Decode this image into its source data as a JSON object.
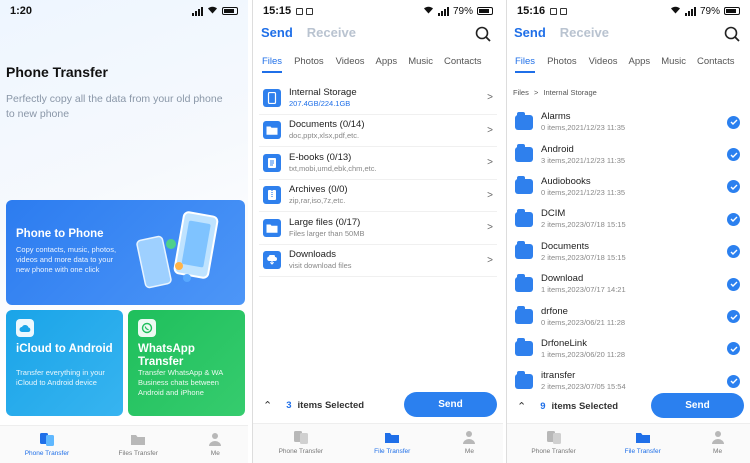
{
  "panel1": {
    "status": {
      "time": "1:20",
      "battery_label": ""
    },
    "title": "Phone Transfer",
    "description": "Perfectly copy all the data from your old phone to new phone",
    "cards": {
      "phone_to_phone": {
        "title": "Phone to Phone",
        "desc": "Copy contacts, music, photos, videos and more data to your new phone with one click"
      },
      "icloud": {
        "title": "iCloud to Android",
        "desc": "Transfer everything in your iCloud to Android device"
      },
      "whatsapp": {
        "title": "WhatsApp Transfer",
        "desc": "Transfer WhatsApp & WA Business chats between Android and iPhone"
      }
    },
    "tabs": [
      "Phone Transfer",
      "Files Transfer",
      "Me"
    ]
  },
  "panel2": {
    "status": {
      "time": "15:15",
      "battery": "79%"
    },
    "seg": {
      "send": "Send",
      "receive": "Receive"
    },
    "categories": [
      "Files",
      "Photos",
      "Videos",
      "Apps",
      "Music",
      "Contacts"
    ],
    "files": [
      {
        "name": "Internal Storage",
        "sub": "207.4GB/224.1GB",
        "icon": "phone-storage-icon"
      },
      {
        "name": "Documents  (0/14)",
        "sub": "doc,pptx,xlsx,pdf,etc.",
        "icon": "folder-icon"
      },
      {
        "name": "E-books  (0/13)",
        "sub": "txt,mobi,umd,ebk,chm,etc.",
        "icon": "book-icon"
      },
      {
        "name": "Archives  (0/0)",
        "sub": "zip,rar,iso,7z,etc.",
        "icon": "archive-icon"
      },
      {
        "name": "Large files  (0/17)",
        "sub": "Files larger than 50MB",
        "icon": "large-file-icon"
      },
      {
        "name": "Downloads",
        "sub": "visit download files",
        "icon": "download-icon"
      }
    ],
    "selected_count": "3",
    "selected_label": "items Selected",
    "send_label": "Send",
    "tabs": [
      "Phone Transfer",
      "File Transfer",
      "Me"
    ]
  },
  "panel3": {
    "status": {
      "time": "15:16",
      "battery": "79%"
    },
    "seg": {
      "send": "Send",
      "receive": "Receive"
    },
    "categories": [
      "Files",
      "Photos",
      "Videos",
      "Apps",
      "Music",
      "Contacts"
    ],
    "breadcrumb": {
      "root": "Files",
      "sep": ">",
      "current": "Internal Storage"
    },
    "folders": [
      {
        "name": "Alarms",
        "sub": "0 items,2021/12/23 11:35"
      },
      {
        "name": "Android",
        "sub": "3 items,2021/12/23 11:35"
      },
      {
        "name": "Audiobooks",
        "sub": "0 items,2021/12/23 11:35"
      },
      {
        "name": "DCIM",
        "sub": "2 items,2023/07/18 15:15"
      },
      {
        "name": "Documents",
        "sub": "2 items,2023/07/18 15:15"
      },
      {
        "name": "Download",
        "sub": "1 items,2023/07/17 14:21"
      },
      {
        "name": "drfone",
        "sub": "0 items,2023/06/21 11:28"
      },
      {
        "name": "DrfoneLink",
        "sub": "1 items,2023/06/20 11:28"
      },
      {
        "name": "itransfer",
        "sub": "2 items,2023/07/05 15:54"
      }
    ],
    "selected_count": "9",
    "selected_label": "items Selected",
    "send_label": "Send",
    "tabs": [
      "Phone Transfer",
      "File Transfer",
      "Me"
    ]
  },
  "colors": {
    "accent": "#1f6fe8",
    "card_blue": "#2c7cf0",
    "card_cyan": "#1aa4e8",
    "card_green": "#1fbf5c"
  }
}
